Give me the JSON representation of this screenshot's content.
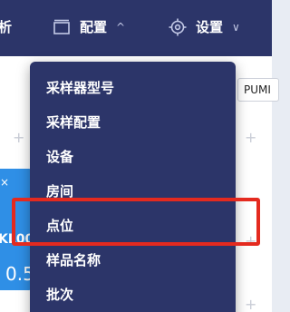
{
  "nav": {
    "partial_label": "析",
    "config_label": "配置",
    "settings_label": "设置",
    "config_icon": "window-icon",
    "settings_icon": "gear-icon",
    "chevron_up": "^",
    "chevron_down": "∨"
  },
  "canvas": {
    "pump_label": "PUMI",
    "equip_title": "KL00",
    "equip_value": "0.5",
    "close_symbol": "×",
    "plus_symbol": "+"
  },
  "dropdown": {
    "items": [
      {
        "label": "采样器型号"
      },
      {
        "label": "采样配置"
      },
      {
        "label": "设备"
      },
      {
        "label": "房间"
      },
      {
        "label": "点位"
      },
      {
        "label": "样品名称"
      },
      {
        "label": "批次"
      }
    ],
    "highlighted_item": "点位"
  },
  "colors": {
    "nav_bg": "#2c3569",
    "menu_bg": "#2c3569",
    "highlight_border": "#e42a1f",
    "equip_bg": "#2f8fe6"
  }
}
